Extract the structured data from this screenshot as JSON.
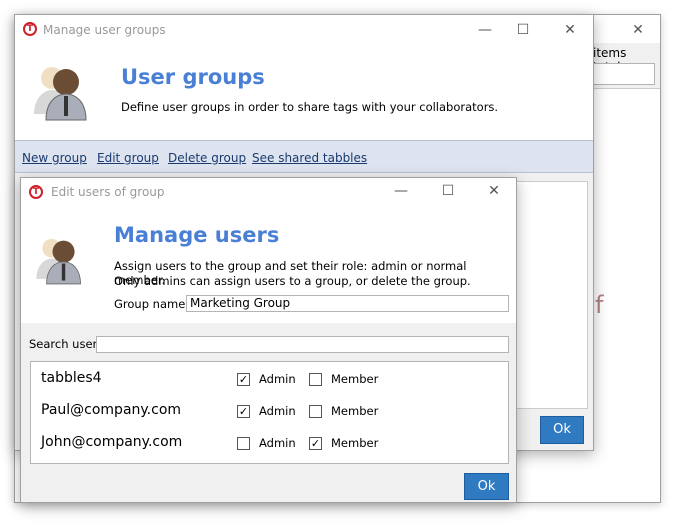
{
  "back_window": {
    "items_total_text": "items total.",
    "partial_text": "f"
  },
  "groups_window": {
    "title": "Manage user groups",
    "heading": "User groups",
    "description": "Define user groups in order to share tags with your collaborators.",
    "links": [
      "New group",
      "Edit group",
      "Delete group",
      "See shared tabbles"
    ],
    "ok_label": "Ok"
  },
  "users_window": {
    "title": "Edit users of group",
    "heading": "Manage users",
    "description_line1": "Assign users to the group and set their role: admin or normal member.",
    "description_line2": "Only admins can assign users to a group, or delete the group.",
    "group_name_label": "Group name",
    "group_name_value": "Marketing Group",
    "search_label": "Search user",
    "search_value": "",
    "admin_label": "Admin",
    "member_label": "Member",
    "users": [
      {
        "name": "tabbles4",
        "admin": true,
        "member": false
      },
      {
        "name": "Paul@company.com",
        "admin": true,
        "member": false
      },
      {
        "name": "John@company.com",
        "admin": false,
        "member": true
      }
    ],
    "ok_label": "Ok"
  },
  "window_controls": {
    "minimize": "—",
    "maximize": "☐",
    "close": "✕"
  },
  "colors": {
    "accent": "#4a7fd6",
    "button": "#2f7ac1",
    "link_bar": "#dde4ef",
    "logo": "#d0202a"
  }
}
